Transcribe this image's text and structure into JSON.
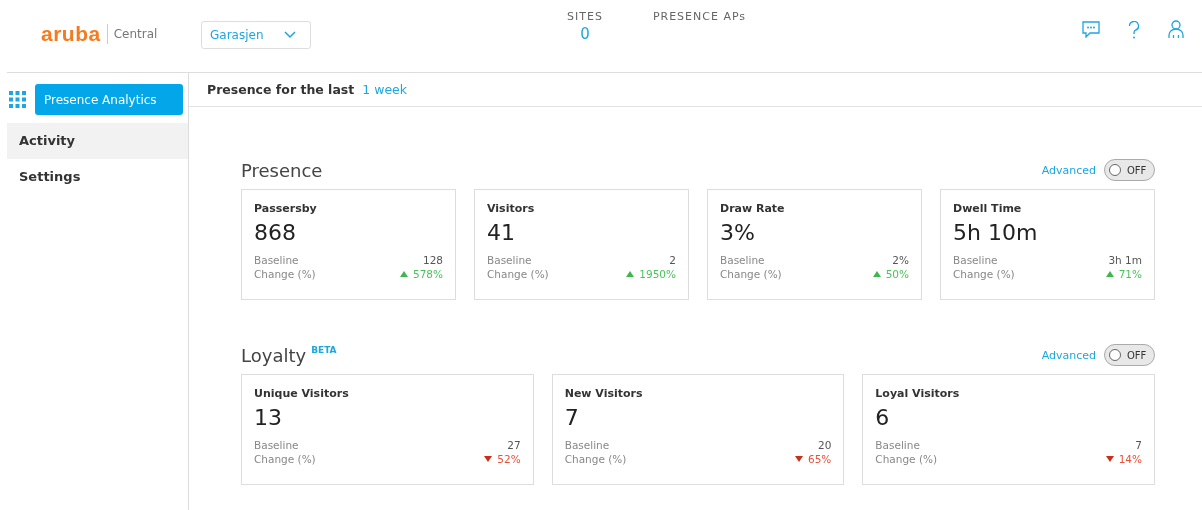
{
  "header": {
    "logo": "aruba",
    "product": "Central",
    "site_select": "Garasjen",
    "stats": [
      {
        "label": "SITES",
        "value": "0"
      },
      {
        "label": "PRESENCE APs"
      }
    ]
  },
  "sidebar": {
    "app_button": "Presence Analytics",
    "items": [
      {
        "label": "Activity",
        "selected": true
      },
      {
        "label": "Settings",
        "selected": false
      }
    ]
  },
  "period": {
    "label": "Presence for the last",
    "value": "1 week"
  },
  "sections": [
    {
      "title": "Presence",
      "advanced": "Advanced",
      "toggle": {
        "on": false,
        "label": "OFF"
      },
      "cards": [
        {
          "title": "Passersby",
          "value": "868",
          "baseline_label": "Baseline",
          "baseline": "128",
          "change_label": "Change (%)",
          "change": "578%",
          "kind": "up"
        },
        {
          "title": "Visitors",
          "value": "41",
          "baseline_label": "Baseline",
          "baseline": "2",
          "change_label": "Change (%)",
          "change": "1950%",
          "kind": "up"
        },
        {
          "title": "Draw Rate",
          "value": "3%",
          "baseline_label": "Baseline",
          "baseline": "2%",
          "change_label": "Change (%)",
          "change": "50%",
          "kind": "up"
        },
        {
          "title": "Dwell Time",
          "value": "5h 10m",
          "baseline_label": "Baseline",
          "baseline": "3h 1m",
          "change_label": "Change (%)",
          "change": "71%",
          "kind": "up"
        }
      ]
    },
    {
      "title": "Loyalty",
      "badge": "BETA",
      "advanced": "Advanced",
      "toggle": {
        "on": false,
        "label": "OFF"
      },
      "cards": [
        {
          "title": "Unique Visitors",
          "value": "13",
          "baseline_label": "Baseline",
          "baseline": "27",
          "change_label": "Change (%)",
          "change": "52%",
          "kind": "down"
        },
        {
          "title": "New Visitors",
          "value": "7",
          "baseline_label": "Baseline",
          "baseline": "20",
          "change_label": "Change (%)",
          "change": "65%",
          "kind": "down"
        },
        {
          "title": "Loyal Visitors",
          "value": "6",
          "baseline_label": "Baseline",
          "baseline": "7",
          "change_label": "Change (%)",
          "change": "14%",
          "kind": "down"
        }
      ]
    }
  ]
}
